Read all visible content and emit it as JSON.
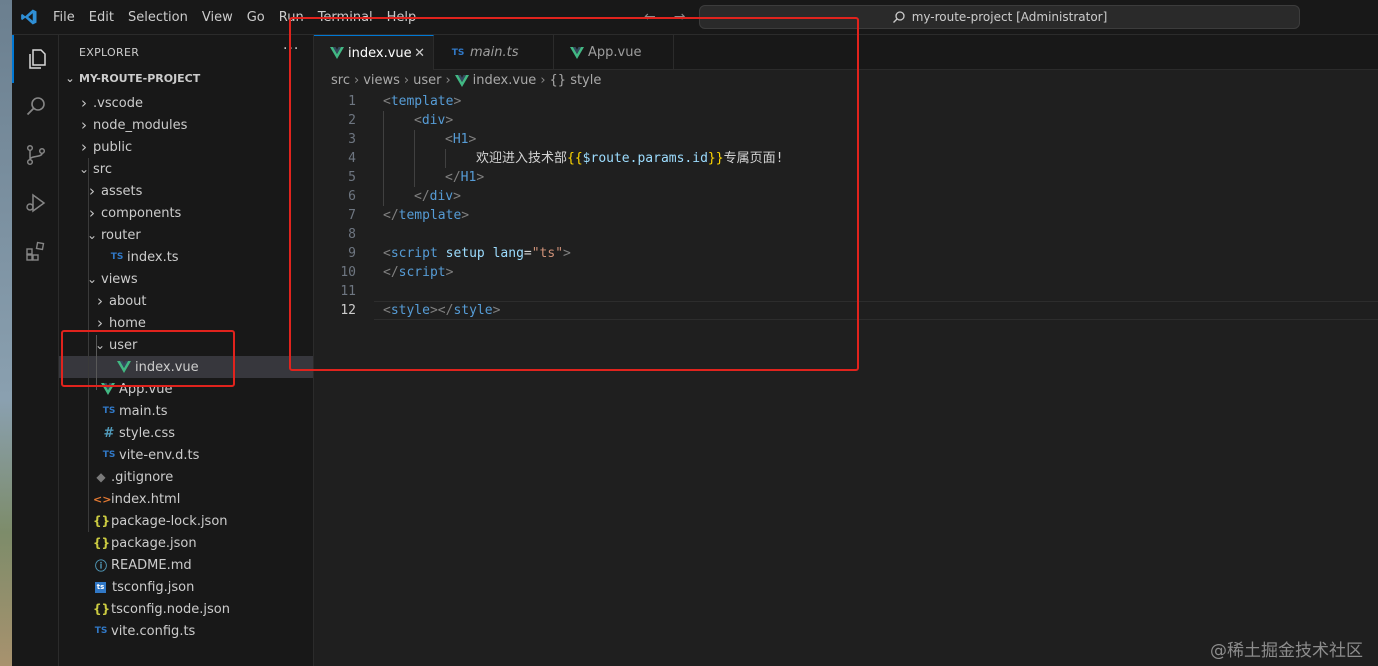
{
  "window": {
    "search_box": "my-route-project [Administrator]",
    "nav_back": "←",
    "nav_forward": "→"
  },
  "menu": [
    "File",
    "Edit",
    "Selection",
    "View",
    "Go",
    "Run",
    "Terminal",
    "Help"
  ],
  "sidebar": {
    "title": "EXPLORER",
    "more": "···",
    "project": "MY-ROUTE-PROJECT",
    "tree": [
      {
        "label": ".vscode",
        "kind": "folder",
        "open": false,
        "depth": 1
      },
      {
        "label": "node_modules",
        "kind": "folder",
        "open": false,
        "depth": 1
      },
      {
        "label": "public",
        "kind": "folder",
        "open": false,
        "depth": 1
      },
      {
        "label": "src",
        "kind": "folder",
        "open": true,
        "depth": 1
      },
      {
        "label": "assets",
        "kind": "folder",
        "open": false,
        "depth": 2
      },
      {
        "label": "components",
        "kind": "folder",
        "open": false,
        "depth": 2
      },
      {
        "label": "router",
        "kind": "folder",
        "open": true,
        "depth": 2
      },
      {
        "label": "index.ts",
        "kind": "ts",
        "depth": 3
      },
      {
        "label": "views",
        "kind": "folder",
        "open": true,
        "depth": 2
      },
      {
        "label": "about",
        "kind": "folder",
        "open": false,
        "depth": 3
      },
      {
        "label": "home",
        "kind": "folder",
        "open": false,
        "depth": 3
      },
      {
        "label": "user",
        "kind": "folder",
        "open": true,
        "depth": 3
      },
      {
        "label": "index.vue",
        "kind": "vue",
        "depth": 4,
        "selected": true
      },
      {
        "label": "App.vue",
        "kind": "vue",
        "depth": 2
      },
      {
        "label": "main.ts",
        "kind": "ts",
        "depth": 2
      },
      {
        "label": "style.css",
        "kind": "css",
        "depth": 2
      },
      {
        "label": "vite-env.d.ts",
        "kind": "ts",
        "depth": 2
      },
      {
        "label": ".gitignore",
        "kind": "git",
        "depth": 1
      },
      {
        "label": "index.html",
        "kind": "html",
        "depth": 1
      },
      {
        "label": "package-lock.json",
        "kind": "json",
        "depth": 1
      },
      {
        "label": "package.json",
        "kind": "json",
        "depth": 1
      },
      {
        "label": "README.md",
        "kind": "info",
        "depth": 1
      },
      {
        "label": "tsconfig.json",
        "kind": "tsconfig",
        "depth": 1
      },
      {
        "label": "tsconfig.node.json",
        "kind": "json",
        "depth": 1
      },
      {
        "label": "vite.config.ts",
        "kind": "ts",
        "depth": 1
      }
    ]
  },
  "tabs": [
    {
      "label": "index.vue",
      "kind": "vue",
      "active": true,
      "close": "✕"
    },
    {
      "label": "main.ts",
      "kind": "ts",
      "active": false,
      "italic": true
    },
    {
      "label": "App.vue",
      "kind": "vue",
      "active": false
    }
  ],
  "breadcrumb": [
    "src",
    "views",
    "user",
    "index.vue",
    "{} style"
  ],
  "code_lines": [
    {
      "n": "1",
      "indent": 0,
      "tokens": [
        [
          "tagp",
          "<"
        ],
        [
          "tag",
          "template"
        ],
        [
          "tagp",
          ">"
        ]
      ]
    },
    {
      "n": "2",
      "indent": 1,
      "tokens": [
        [
          "tagp",
          "<"
        ],
        [
          "tag",
          "div"
        ],
        [
          "tagp",
          ">"
        ]
      ]
    },
    {
      "n": "3",
      "indent": 2,
      "tokens": [
        [
          "tagp",
          "<"
        ],
        [
          "tag",
          "H1"
        ],
        [
          "tagp",
          ">"
        ]
      ]
    },
    {
      "n": "4",
      "indent": 3,
      "tokens": [
        [
          "txt",
          "欢迎进入技术部"
        ],
        [
          "br",
          "{{"
        ],
        [
          "var",
          "$route.params.id"
        ],
        [
          "br",
          "}}"
        ],
        [
          "txt",
          "专属页面!"
        ]
      ]
    },
    {
      "n": "5",
      "indent": 2,
      "tokens": [
        [
          "tagp",
          "</"
        ],
        [
          "tag",
          "H1"
        ],
        [
          "tagp",
          ">"
        ]
      ]
    },
    {
      "n": "6",
      "indent": 1,
      "tokens": [
        [
          "tagp",
          "</"
        ],
        [
          "tag",
          "div"
        ],
        [
          "tagp",
          ">"
        ]
      ]
    },
    {
      "n": "7",
      "indent": 0,
      "tokens": [
        [
          "tagp",
          "</"
        ],
        [
          "tag",
          "template"
        ],
        [
          "tagp",
          ">"
        ]
      ]
    },
    {
      "n": "8",
      "indent": 0,
      "tokens": []
    },
    {
      "n": "9",
      "indent": 0,
      "tokens": [
        [
          "tagp",
          "<"
        ],
        [
          "tag",
          "script"
        ],
        [
          "txt",
          " "
        ],
        [
          "attr",
          "setup"
        ],
        [
          "txt",
          " "
        ],
        [
          "attr",
          "lang"
        ],
        [
          "txt",
          "="
        ],
        [
          "str",
          "\"ts\""
        ],
        [
          "tagp",
          ">"
        ]
      ]
    },
    {
      "n": "10",
      "indent": 0,
      "tokens": [
        [
          "tagp",
          "</"
        ],
        [
          "tag",
          "script"
        ],
        [
          "tagp",
          ">"
        ]
      ]
    },
    {
      "n": "11",
      "indent": 0,
      "tokens": []
    },
    {
      "n": "12",
      "indent": 0,
      "current": true,
      "tokens": [
        [
          "tagp",
          "<"
        ],
        [
          "tag",
          "style"
        ],
        [
          "tagp",
          "></"
        ],
        [
          "tag",
          "style"
        ],
        [
          "tagp",
          ">"
        ]
      ]
    }
  ],
  "watermark": "@稀土掘金技术社区",
  "colors": {
    "accent": "#0078d4",
    "highlight": "#e0231d",
    "vue": "#42b883",
    "ts": "#3178c6"
  }
}
